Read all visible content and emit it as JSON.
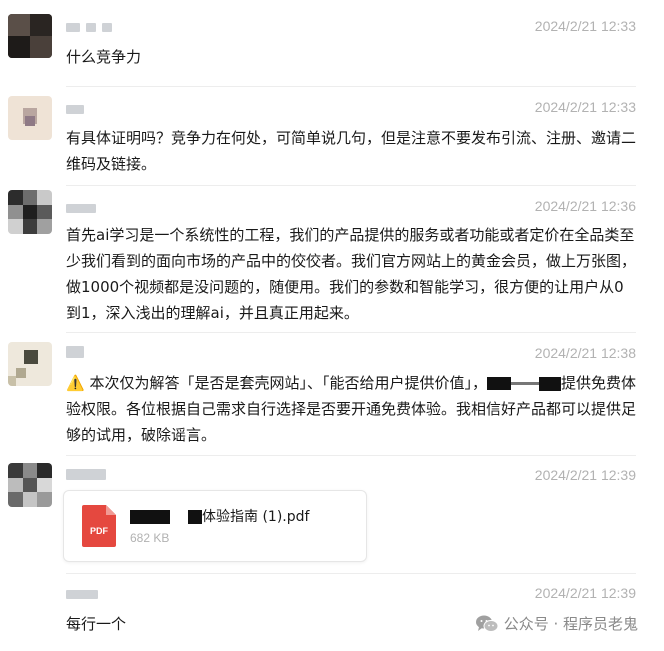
{
  "messages": [
    {
      "time": "2024/2/21 12:33",
      "text": "什么竞争力"
    },
    {
      "time": "2024/2/21 12:33",
      "text": "有具体证明吗？竞争力在何处，可简单说几句，但是注意不要发布引流、注册、邀请二维码及链接。"
    },
    {
      "time": "2024/2/21 12:36",
      "text": "首先ai学习是一个系统性的工程，我们的产品提供的服务或者功能或者定价在全品类至少我们看到的面向市场的产品中的佼佼者。我们官方网站上的黄金会员，做上万张图，做1000个视频都是没问题的，随便用。我们的参数和智能学习，很方便的让用户从0到1，深入浅出的理解ai，并且真正用起来。"
    },
    {
      "time": "2024/2/21 12:38",
      "warning_icon": "⚠️",
      "text_part1": "本次仅为解答「是否是套壳网站」、「能否给用户提供价值」，",
      "text_part2": "提供免费体验权限。各位根据自己需求自行选择是否要开通免费体验。我相信好产品都可以提供足够的试用，破除谣言。"
    },
    {
      "time": "2024/2/21 12:39",
      "file": {
        "name_suffix": "体验指南 (1).pdf",
        "size": "682 KB",
        "type_label": "PDF"
      }
    },
    {
      "time": "2024/2/21 12:39",
      "text": "每行一个"
    }
  ],
  "watermark": {
    "icon": "wechat-icon",
    "text": "公众号 · 程序员老鬼"
  },
  "colors": {
    "time": "#b2b2b2",
    "pdf_red": "#e5483f",
    "warning": "#f5b800"
  }
}
